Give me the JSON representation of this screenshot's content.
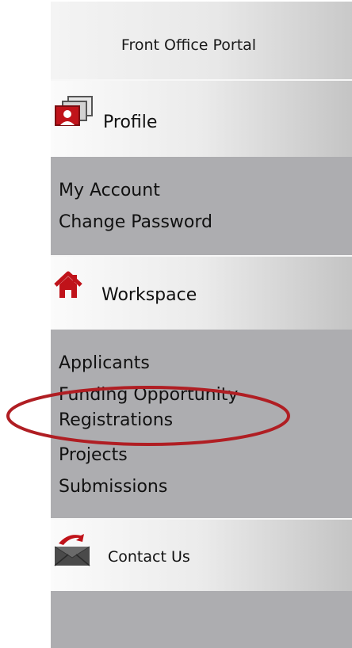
{
  "portal": {
    "title": "Front Office Portal"
  },
  "sections": {
    "profile": {
      "label": "Profile",
      "icon": "profile-cards-icon",
      "links": [
        "My Account",
        "Change Password"
      ]
    },
    "workspace": {
      "label": "Workspace",
      "icon": "home-icon",
      "links": [
        "Applicants",
        "Funding Opportunity Registrations",
        "Projects",
        "Submissions"
      ],
      "link_lines": {
        "funding_line1": "Funding Opportunity",
        "funding_line2": "Registrations"
      }
    },
    "contact": {
      "label": "Contact Us",
      "icon": "envelope-icon"
    }
  },
  "colors": {
    "panel": "#adadb0",
    "accent": "#c0131a",
    "highlight_ring": "#b01e23"
  }
}
